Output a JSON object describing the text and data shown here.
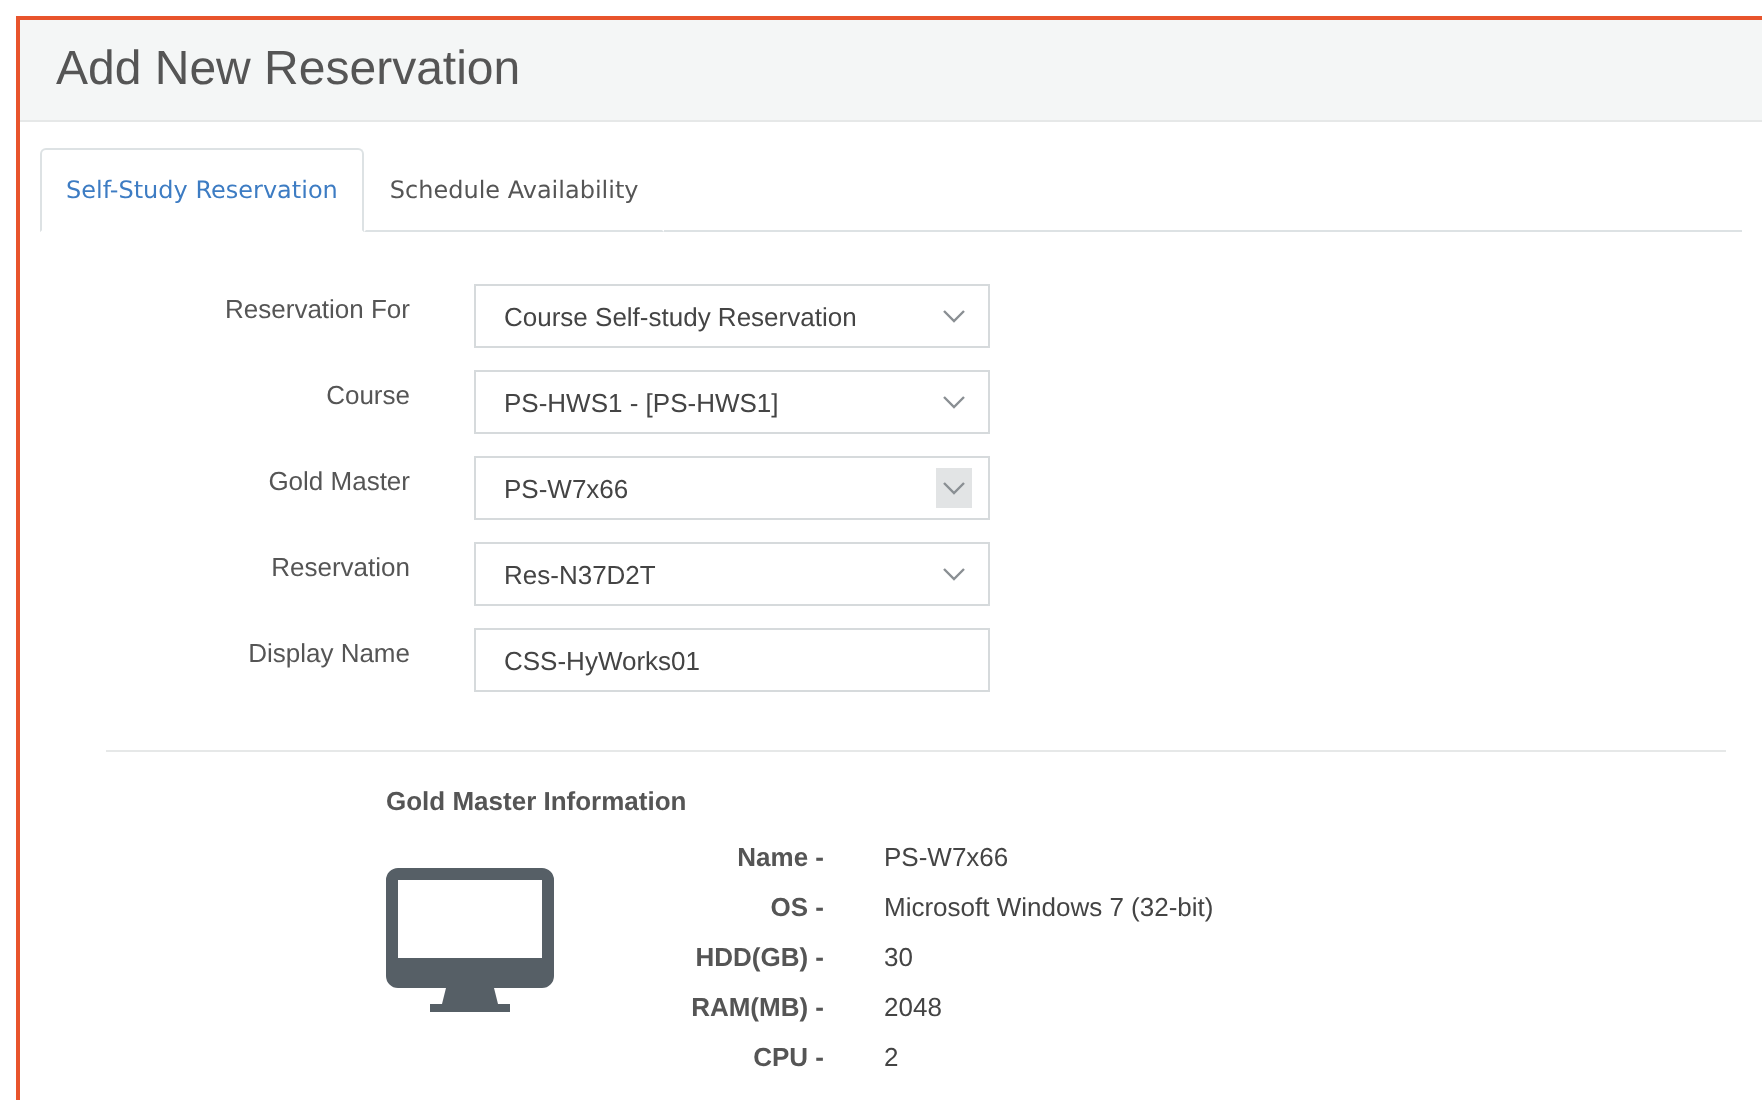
{
  "title": "Add New Reservation",
  "tabs": [
    {
      "label": "Self-Study Reservation",
      "selected": true
    },
    {
      "label": "Schedule Availability",
      "selected": false
    }
  ],
  "fields": [
    {
      "label": "Reservation For",
      "kind": "select",
      "value": "Course Self-study Reservation",
      "arrow_highlighted": false
    },
    {
      "label": "Course",
      "kind": "select",
      "value": "PS-HWS1 - [PS-HWS1]",
      "arrow_highlighted": false
    },
    {
      "label": "Gold Master",
      "kind": "select",
      "value": "PS-W7x66",
      "arrow_highlighted": true
    },
    {
      "label": "Reservation",
      "kind": "select",
      "value": "Res-N37D2T",
      "arrow_highlighted": false
    },
    {
      "label": "Display Name",
      "kind": "text",
      "value": "CSS-HyWorks01"
    }
  ],
  "info": {
    "heading": "Gold Master Information",
    "rows": [
      {
        "label": "Name -",
        "value": "PS-W7x66"
      },
      {
        "label": "OS -",
        "value": "Microsoft Windows 7 (32-bit)"
      },
      {
        "label": "HDD(GB) -",
        "value": "30"
      },
      {
        "label": "RAM(MB) -",
        "value": "2048"
      },
      {
        "label": "CPU -",
        "value": "2"
      }
    ]
  }
}
